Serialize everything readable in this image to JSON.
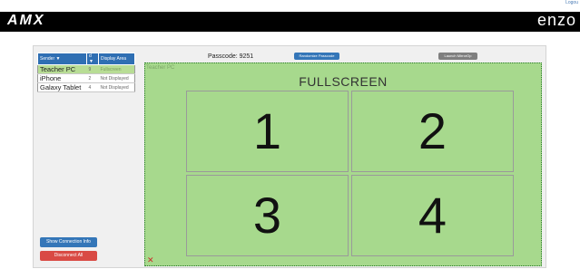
{
  "header": {
    "logout_label": "Logou",
    "brand_left": "AMX",
    "brand_right": "enzo"
  },
  "senders_table": {
    "columns": [
      "Sender ▼",
      "d ▼",
      "Display Area"
    ],
    "rows": [
      {
        "name": "Teacher PC",
        "id": "9",
        "area": "Fullscreen",
        "selected": true
      },
      {
        "name": "iPhone",
        "id": "2",
        "area": "Not Displayed",
        "selected": false
      },
      {
        "name": "Galaxy Tablet",
        "id": "4",
        "area": "Not Displayed",
        "selected": false
      }
    ]
  },
  "buttons": {
    "show_connection_info": "Show Connection Info",
    "disconnect_all": "Disconnect All",
    "randomize_passcode": "Randomize Passcode",
    "launch_mirrorop": "Launch MirrorOp"
  },
  "passcode_label": "Passcode: 9251",
  "display": {
    "source": "Teacher PC",
    "mode": "FULLSCREEN",
    "quadrants": [
      "1",
      "2",
      "3",
      "4"
    ],
    "close_glyph": "✕"
  },
  "colors": {
    "primary_button": "#3476b8",
    "danger_button": "#d94a44",
    "display_bg": "#a7d98d",
    "selected_row": "#b8dd95"
  }
}
